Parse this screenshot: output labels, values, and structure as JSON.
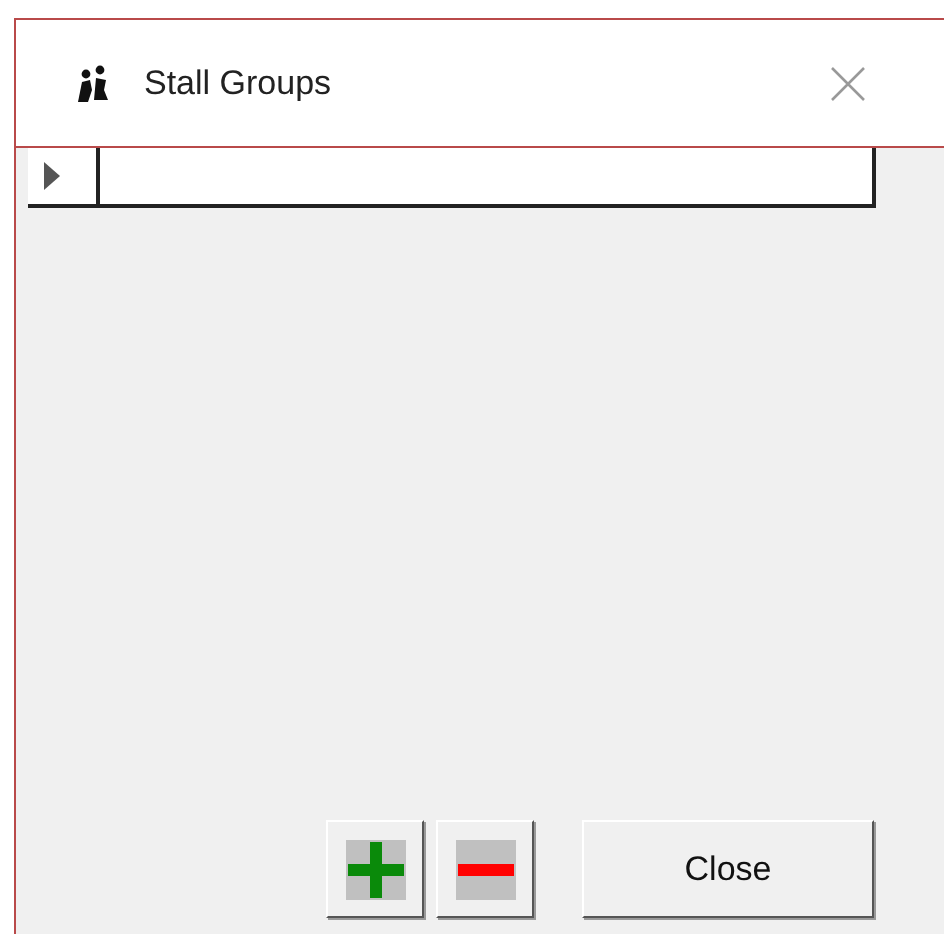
{
  "window": {
    "title": "Stall Groups"
  },
  "grid": {
    "rows": [
      {
        "current": true
      }
    ]
  },
  "buttons": [
    {
      "kind": "add"
    },
    {
      "kind": "remove"
    },
    {
      "kind": "text",
      "label": "Close"
    }
  ]
}
